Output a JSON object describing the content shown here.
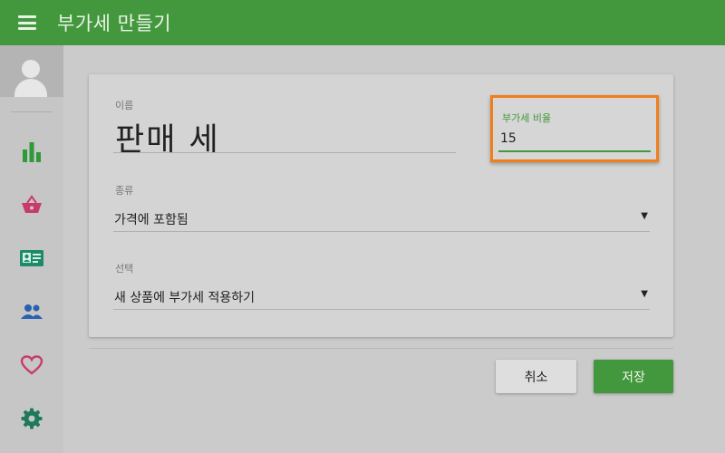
{
  "header": {
    "title": "부가세 만들기",
    "menu_icon": "hamburger-menu-icon",
    "bg_color": "#43983e"
  },
  "sidebar": {
    "items": [
      {
        "name": "bar-chart-icon",
        "color": "#2e9a3a"
      },
      {
        "name": "basket-icon",
        "color": "#c93c6a"
      },
      {
        "name": "contact-card-icon",
        "color": "#1e8a6a"
      },
      {
        "name": "people-icon",
        "color": "#2b5fb0"
      },
      {
        "name": "heart-icon",
        "color": "#c93c6a"
      },
      {
        "name": "gear-icon",
        "color": "#1e7a5a"
      }
    ]
  },
  "form": {
    "name_label": "이름",
    "name_value": "판매 세",
    "rate_label": "부가세 비율",
    "rate_value": "15",
    "type_label": "종류",
    "type_value": "가격에 포함됨",
    "option_label": "선택",
    "option_value": "새 상품에 부가세 적용하기",
    "dropdown_arrow": "▼"
  },
  "actions": {
    "cancel_label": "취소",
    "save_label": "저장"
  },
  "colors": {
    "accent": "#43983e",
    "highlight": "#f07e1b"
  }
}
